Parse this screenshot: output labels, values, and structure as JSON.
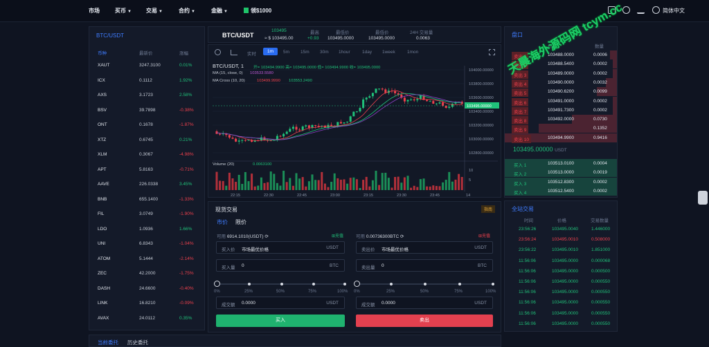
{
  "topnav": {
    "items": [
      "市场",
      "买币",
      "交易",
      "合约",
      "金融"
    ],
    "balance": "领$1000",
    "lang": "简体中文"
  },
  "pair_panel": {
    "title": "BTC/USDT",
    "headers": [
      "币种",
      "最新价",
      "涨幅"
    ],
    "rows": [
      {
        "sym": "XAUT",
        "price": "3247.3100",
        "chg": "0.01%",
        "up": true
      },
      {
        "sym": "ICX",
        "price": "0.1112",
        "chg": "1.92%",
        "up": true
      },
      {
        "sym": "AXS",
        "price": "3.1723",
        "chg": "2.58%",
        "up": true
      },
      {
        "sym": "BSV",
        "price": "39.7898",
        "chg": "-0.38%",
        "up": false
      },
      {
        "sym": "ONT",
        "price": "0.1678",
        "chg": "-1.87%",
        "up": false
      },
      {
        "sym": "XTZ",
        "price": "0.6745",
        "chg": "0.21%",
        "up": true
      },
      {
        "sym": "XLM",
        "price": "0.3067",
        "chg": "-4.98%",
        "up": false
      },
      {
        "sym": "APT",
        "price": "5.8163",
        "chg": "-0.71%",
        "up": false
      },
      {
        "sym": "AAVE",
        "price": "226.0338",
        "chg": "3.45%",
        "up": true
      },
      {
        "sym": "BNB",
        "price": "655.1400",
        "chg": "-1.33%",
        "up": false
      },
      {
        "sym": "FIL",
        "price": "3.0749",
        "chg": "-1.90%",
        "up": false
      },
      {
        "sym": "LDO",
        "price": "1.0936",
        "chg": "1.66%",
        "up": true
      },
      {
        "sym": "UNI",
        "price": "6.8343",
        "chg": "-1.04%",
        "up": false
      },
      {
        "sym": "ATOM",
        "price": "5.1444",
        "chg": "-2.14%",
        "up": false
      },
      {
        "sym": "ZEC",
        "price": "42.2000",
        "chg": "-1.75%",
        "up": false
      },
      {
        "sym": "DASH",
        "price": "24.6600",
        "chg": "-0.40%",
        "up": false
      },
      {
        "sym": "LINK",
        "price": "16.8210",
        "chg": "-0.09%",
        "up": false
      },
      {
        "sym": "AVAX",
        "price": "24.0112",
        "chg": "0.35%",
        "up": true
      }
    ]
  },
  "ticker": {
    "pair": "BTC/USDT",
    "last": "103495",
    "last_usd": "≈ $ 103495.00",
    "chg": "+0.93",
    "high_label": "最高",
    "high": "103495.0000",
    "low_label": "最低价",
    "low": "103495.0000",
    "low_label2": "最低价",
    "low2": "103494.9900",
    "vol_label": "24H 交易量",
    "vol": "0.0063"
  },
  "chart": {
    "timeframes": [
      "实时",
      "1m",
      "5m",
      "15m",
      "30m",
      "1hour",
      "1day",
      "1week",
      "1mon"
    ],
    "active": "1m",
    "legend_title": "BTC/USDT, 1",
    "ohlc": "开= 103494.9900 高= 103495.0000 低= 103494.9900 收= 103495.0000",
    "ma1": "MA (15, close, 0)",
    "ma1_val": "103533.5580",
    "ma2": "MA Cross (10, 20)",
    "ma2_a": "103499.9990",
    "ma2_b": "103553.2490",
    "yticks": [
      "104000.00000",
      "103800.00000",
      "103600.00000",
      "103400.00000",
      "103200.00000",
      "103000.00000",
      "102800.00000"
    ],
    "price_tag": "103495.00000",
    "vol_label": "Volume (20)",
    "vol_val": "0.0063100",
    "vol_ticks": [
      "10",
      "5"
    ],
    "xticks": [
      "22:15",
      "22:30",
      "22:45",
      "23:00",
      "23:15",
      "23:30",
      "23:45",
      "14"
    ]
  },
  "trade": {
    "title": "现货交易",
    "tag": "指南",
    "tabs": [
      "市价",
      "限价"
    ],
    "buy": {
      "avail_label": "可用",
      "avail": "6914.1010(USDT)",
      "transfer": "充值",
      "price_label": "买入价",
      "price": "市场最优价格",
      "price_unit": "USDT",
      "qty_label": "买入量",
      "qty": "0",
      "qty_unit": "BTC",
      "amt_label": "成交额",
      "amt": "0.0000",
      "amt_unit": "USDT",
      "button": "买入"
    },
    "sell": {
      "avail_label": "可用",
      "avail": "0.00736300BTC",
      "transfer": "充值",
      "price_label": "卖出价",
      "price": "市场最优价格",
      "price_unit": "USDT",
      "qty_label": "卖出量",
      "qty": "0",
      "qty_unit": "BTC",
      "amt_label": "成交额",
      "amt": "0.0000",
      "amt_unit": "USDT",
      "button": "卖出"
    },
    "pcts": [
      "0%",
      "25%",
      "50%",
      "75%",
      "100%"
    ]
  },
  "orderbook": {
    "title": "盘口",
    "headers": [
      "",
      "价格",
      "数量"
    ],
    "sells": [
      {
        "label": "卖出 1",
        "price": "103488.0000",
        "qty": "0.0006"
      },
      {
        "label": "卖出 2",
        "price": "103488.5400",
        "qty": "0.0002"
      },
      {
        "label": "卖出 3",
        "price": "103489.0000",
        "qty": "0.0002"
      },
      {
        "label": "卖出 4",
        "price": "103490.0000",
        "qty": "0.0032"
      },
      {
        "label": "卖出 5",
        "price": "103490.6200",
        "qty": "0.0099"
      },
      {
        "label": "卖出 6",
        "price": "103491.0000",
        "qty": "0.0002"
      },
      {
        "label": "卖出 7",
        "price": "103491.7300",
        "qty": "0.0002"
      },
      {
        "label": "卖出 8",
        "price": "103492.0000",
        "qty": "0.0730"
      },
      {
        "label": "卖出 9",
        "price": "",
        "qty": "0.1352"
      },
      {
        "label": "卖出 10",
        "price": "103494.9900",
        "qty": "0.9416"
      }
    ],
    "mid": "103495.00000",
    "mid_unit": "USDT",
    "buys": [
      {
        "label": "买入 1",
        "price": "103513.0100",
        "qty": "0.0004"
      },
      {
        "label": "买入 2",
        "price": "103513.0000",
        "qty": "0.0019"
      },
      {
        "label": "买入 3",
        "price": "103512.8300",
        "qty": "0.0002"
      },
      {
        "label": "买入 4",
        "price": "103512.5400",
        "qty": "0.0002"
      }
    ]
  },
  "trades": {
    "title": "全站交易",
    "headers": [
      "时间",
      "价格",
      "交易数量"
    ],
    "rows": [
      {
        "t": "23:56:26",
        "p": "103495.0040",
        "q": "1.446000",
        "c": "green"
      },
      {
        "t": "23:56:24",
        "p": "103495.0010",
        "q": "0.508000",
        "c": "red"
      },
      {
        "t": "23:56:22",
        "p": "103495.0010",
        "q": "1.851000",
        "c": "green"
      },
      {
        "t": "11:56:06",
        "p": "103495.0000",
        "q": "0.000068",
        "c": "green"
      },
      {
        "t": "11:56:06",
        "p": "103495.0000",
        "q": "0.000500",
        "c": "green"
      },
      {
        "t": "11:56:06",
        "p": "103495.0000",
        "q": "0.000550",
        "c": "green"
      },
      {
        "t": "11:56:06",
        "p": "103495.0000",
        "q": "0.000550",
        "c": "green"
      },
      {
        "t": "11:56:06",
        "p": "103495.0000",
        "q": "0.000550",
        "c": "green"
      },
      {
        "t": "11:56:06",
        "p": "103495.0000",
        "q": "0.000550",
        "c": "green"
      },
      {
        "t": "11:56:06",
        "p": "103495.0000",
        "q": "0.000550",
        "c": "green"
      }
    ]
  },
  "bottom_tabs": [
    "当前委托",
    "历史委托"
  ],
  "watermark": "天晨海外源码网 tcym.cc",
  "colors": {
    "green": "#20c27a",
    "red": "#f0414d",
    "accent": "#2a6cf0"
  }
}
